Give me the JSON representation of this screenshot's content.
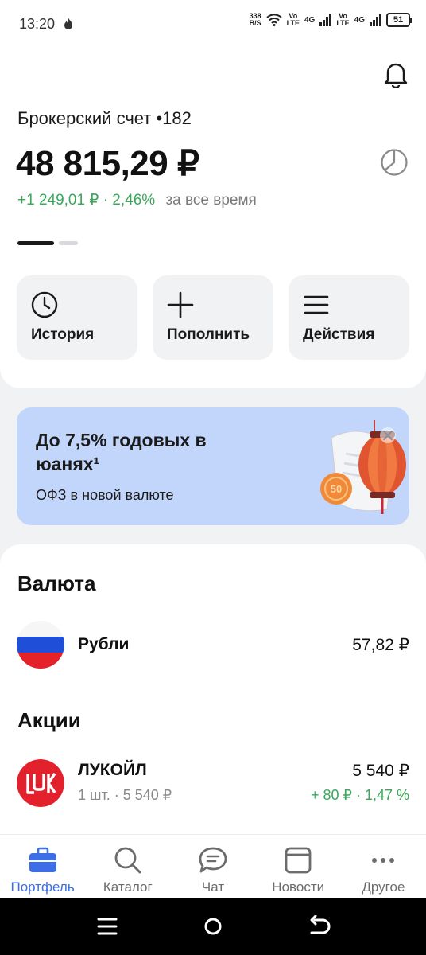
{
  "status_bar": {
    "time": "13:20",
    "net_speed_value": "338",
    "net_speed_unit": "B/S",
    "volte1_top": "Vo",
    "volte1_bottom": "LTE",
    "net1": "4G",
    "volte2_top": "Vo",
    "volte2_bottom": "LTE",
    "net2": "4G",
    "battery": "51"
  },
  "account": {
    "name": "Брокерский счет •182",
    "balance": "48 815,29 ₽",
    "gain": "+1 249,01 ₽ · 2,46%",
    "gain_period": "за все время"
  },
  "actions": [
    {
      "label": "История",
      "icon": "clock-icon"
    },
    {
      "label": "Пополнить",
      "icon": "plus-icon"
    },
    {
      "label": "Действия",
      "icon": "menu-icon"
    }
  ],
  "promo": {
    "title": "До 7,5% годовых в юанях¹",
    "subtitle": "ОФЗ в новой валюте",
    "coin_text": "50"
  },
  "holdings": {
    "currency_title": "Валюта",
    "currency_row": {
      "name": "Рубли",
      "value": "57,82 ₽"
    },
    "stocks_title": "Акции",
    "stock_row": {
      "name": "ЛУКОЙЛ",
      "sub": "1 шт. · 5 540 ₽",
      "value": "5 540 ₽",
      "change": "+ 80 ₽ · 1,47 %"
    }
  },
  "nav": [
    {
      "label": "Портфель",
      "icon": "briefcase-icon",
      "active": true
    },
    {
      "label": "Каталог",
      "icon": "search-icon",
      "active": false
    },
    {
      "label": "Чат",
      "icon": "chat-icon",
      "active": false
    },
    {
      "label": "Новости",
      "icon": "news-icon",
      "active": false
    },
    {
      "label": "Другое",
      "icon": "more-icon",
      "active": false
    }
  ],
  "colors": {
    "accent": "#3d6ee8",
    "positive": "#3aa85a",
    "promo_bg": "#c2d6fb",
    "lukoil_red": "#e3212d"
  }
}
